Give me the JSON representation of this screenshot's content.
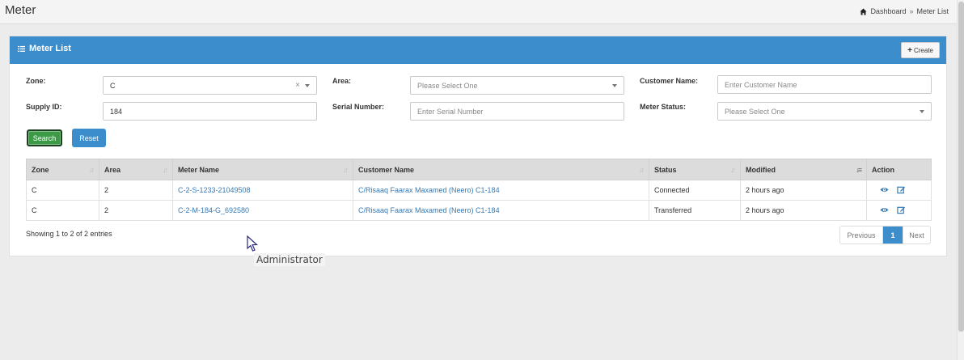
{
  "header": {
    "title": "Meter",
    "breadcrumb": {
      "home": "Dashboard",
      "separator": "»",
      "current": "Meter List"
    }
  },
  "panel": {
    "title": "Meter List",
    "create_label": "Create",
    "accent_color": "#3c8dcb"
  },
  "filters": {
    "zone": {
      "label": "Zone:",
      "value": "C"
    },
    "area": {
      "label": "Area:",
      "placeholder": "Please Select One"
    },
    "customer_name": {
      "label": "Customer Name:",
      "placeholder": "Enter Customer Name"
    },
    "supply_id": {
      "label": "Supply ID:",
      "value": "184"
    },
    "serial_number": {
      "label": "Serial Number:",
      "placeholder": "Enter Serial Number"
    },
    "meter_status": {
      "label": "Meter Status:",
      "placeholder": "Please Select One"
    },
    "search_label": "Search",
    "reset_label": "Reset"
  },
  "table": {
    "columns": [
      "Zone",
      "Area",
      "Meter Name",
      "Customer Name",
      "Status",
      "Modified",
      "Action"
    ],
    "rows": [
      {
        "zone": "C",
        "area": "2",
        "meter_name": "C-2-S-1233-21049508",
        "customer_name": "C/Risaaq Faarax Maxamed (Neero) C1-184",
        "status": "Connected",
        "modified": "2 hours ago"
      },
      {
        "zone": "C",
        "area": "2",
        "meter_name": "C-2-M-184-G_692580",
        "customer_name": "C/Risaaq Faarax Maxamed (Neero) C1-184",
        "status": "Transferred",
        "modified": "2 hours ago"
      }
    ]
  },
  "footer": {
    "info": "Showing 1 to 2 of 2 entries",
    "prev": "Previous",
    "page": "1",
    "next": "Next"
  },
  "tooltip": "Administrator"
}
